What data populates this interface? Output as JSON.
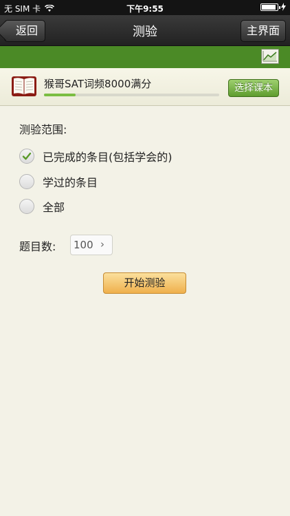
{
  "status": {
    "carrier": "无 SIM 卡",
    "time": "下午9:55",
    "battery_level": 0.9
  },
  "nav": {
    "back_label": "返回",
    "title": "测验",
    "home_label": "主界面"
  },
  "toolbar": {
    "chart_icon": "line-chart-icon"
  },
  "book": {
    "title": "猴哥SAT词频8000满分",
    "progress": 0.18,
    "select_label": "选择课本",
    "icon": "book-icon"
  },
  "quiz": {
    "scope_label": "测验范围:",
    "options": [
      {
        "label": "已完成的条目(包括学会的)",
        "checked": true
      },
      {
        "label": "学过的条目",
        "checked": false
      },
      {
        "label": "全部",
        "checked": false
      }
    ],
    "count_label": "题目数:",
    "count_value": "100",
    "start_label": "开始测验"
  },
  "colors": {
    "green_bar": "#4b8a26",
    "select_button": "#6aa63a",
    "start_button": "#f5c56b",
    "background": "#f3f2e7",
    "check": "#5a9a2a"
  }
}
